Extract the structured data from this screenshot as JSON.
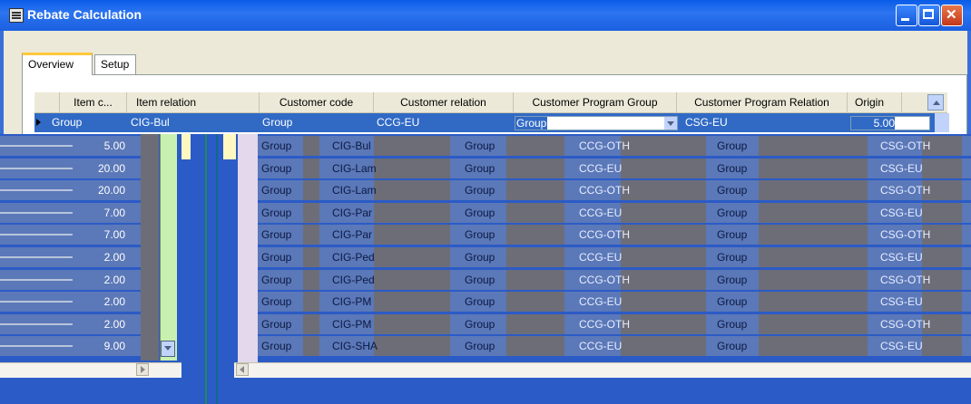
{
  "window": {
    "title": "Rebate Calculation"
  },
  "tabs": [
    {
      "label": "Overview",
      "active": true
    },
    {
      "label": "Setup",
      "active": false
    }
  ],
  "grid": {
    "columns": [
      "Item c...",
      "Item relation",
      "Customer code",
      "Customer relation",
      "Customer Program Group",
      "Customer Program Relation",
      "Origin"
    ],
    "selected_row": {
      "item_code": "Group",
      "item_relation": "CIG-Bul",
      "customer_code": "Group",
      "customer_relation": "CCG-EU",
      "customer_program_group": "Group",
      "customer_program_relation": "CSG-EU",
      "origin": "5.00"
    }
  },
  "rows": [
    {
      "origin": "5.00",
      "item_code": "Group",
      "item_relation": "CIG-Bul",
      "customer_code": "Group",
      "customer_relation": "CCG-OTH",
      "program_group": "Group",
      "program_relation": "CSG-OTH"
    },
    {
      "origin": "20.00",
      "item_code": "Group",
      "item_relation": "CIG-Lam",
      "customer_code": "Group",
      "customer_relation": "CCG-EU",
      "program_group": "Group",
      "program_relation": "CSG-EU"
    },
    {
      "origin": "20.00",
      "item_code": "Group",
      "item_relation": "CIG-Lam",
      "customer_code": "Group",
      "customer_relation": "CCG-OTH",
      "program_group": "Group",
      "program_relation": "CSG-OTH"
    },
    {
      "origin": "7.00",
      "item_code": "Group",
      "item_relation": "CIG-Par",
      "customer_code": "Group",
      "customer_relation": "CCG-EU",
      "program_group": "Group",
      "program_relation": "CSG-EU"
    },
    {
      "origin": "7.00",
      "item_code": "Group",
      "item_relation": "CIG-Par",
      "customer_code": "Group",
      "customer_relation": "CCG-OTH",
      "program_group": "Group",
      "program_relation": "CSG-OTH"
    },
    {
      "origin": "2.00",
      "item_code": "Group",
      "item_relation": "CIG-Ped",
      "customer_code": "Group",
      "customer_relation": "CCG-EU",
      "program_group": "Group",
      "program_relation": "CSG-EU"
    },
    {
      "origin": "2.00",
      "item_code": "Group",
      "item_relation": "CIG-Ped",
      "customer_code": "Group",
      "customer_relation": "CCG-OTH",
      "program_group": "Group",
      "program_relation": "CSG-OTH"
    },
    {
      "origin": "2.00",
      "item_code": "Group",
      "item_relation": "CIG-PM",
      "customer_code": "Group",
      "customer_relation": "CCG-EU",
      "program_group": "Group",
      "program_relation": "CSG-EU"
    },
    {
      "origin": "2.00",
      "item_code": "Group",
      "item_relation": "CIG-PM",
      "customer_code": "Group",
      "customer_relation": "CCG-OTH",
      "program_group": "Group",
      "program_relation": "CSG-OTH"
    },
    {
      "origin": "9.00",
      "item_code": "Group",
      "item_relation": "CIG-SHA",
      "customer_code": "Group",
      "customer_relation": "CCG-EU",
      "program_group": "Group",
      "program_relation": "CSG-EU"
    }
  ],
  "colors": {
    "selection": "#316ac5",
    "titlebar": "#0a5ce8",
    "tab_highlight": "#ffc83c"
  },
  "icons": [
    "window-app-icon",
    "minimize-icon",
    "maximize-icon",
    "close-icon",
    "row-pointer-icon",
    "dropdown-arrow-icon",
    "scroll-up-icon",
    "scroll-down-icon",
    "scroll-left-icon",
    "scroll-right-icon"
  ]
}
